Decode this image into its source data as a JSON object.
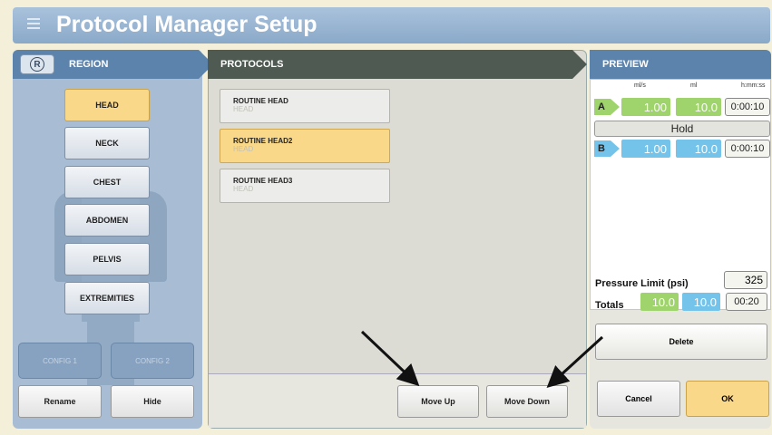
{
  "title": "Protocol Manager Setup",
  "region": {
    "header": "REGION",
    "r_button": "R",
    "items": [
      {
        "label": "HEAD",
        "selected": true
      },
      {
        "label": "NECK",
        "selected": false
      },
      {
        "label": "CHEST",
        "selected": false
      },
      {
        "label": "ABDOMEN",
        "selected": false
      },
      {
        "label": "PELVIS",
        "selected": false
      },
      {
        "label": "EXTREMITIES",
        "selected": false
      }
    ],
    "config1": "CONFIG 1",
    "config2": "CONFIG 2",
    "rename": "Rename",
    "hide": "Hide"
  },
  "protocols": {
    "header": "PROTOCOLS",
    "items": [
      {
        "name": "ROUTINE HEAD",
        "region": "HEAD",
        "selected": false
      },
      {
        "name": "ROUTINE HEAD2",
        "region": "HEAD",
        "selected": true
      },
      {
        "name": "ROUTINE HEAD3",
        "region": "HEAD",
        "selected": false
      }
    ],
    "move_up": "Move Up",
    "move_down": "Move Down"
  },
  "preview": {
    "header": "PREVIEW",
    "col_flow": "ml/s",
    "col_volume": "ml",
    "col_time": "h:mm:ss",
    "phase_a": {
      "tag": "A",
      "flow": "1.00",
      "volume": "10.0",
      "time": "0:00:10"
    },
    "hold": "Hold",
    "phase_b": {
      "tag": "B",
      "flow": "1.00",
      "volume": "10.0",
      "time": "0:00:10"
    },
    "pressure_label": "Pressure Limit (psi)",
    "pressure_value": "325",
    "totals_label": "Totals",
    "totals_a": "10.0",
    "totals_b": "10.0",
    "totals_time": "00:20",
    "delete": "Delete",
    "cancel": "Cancel",
    "ok": "OK"
  },
  "colors": {
    "accent_selected": "#fad889",
    "contrast_green": "#9ed46b",
    "saline_blue": "#74c3ea",
    "header_blue": "#5c83ac"
  }
}
